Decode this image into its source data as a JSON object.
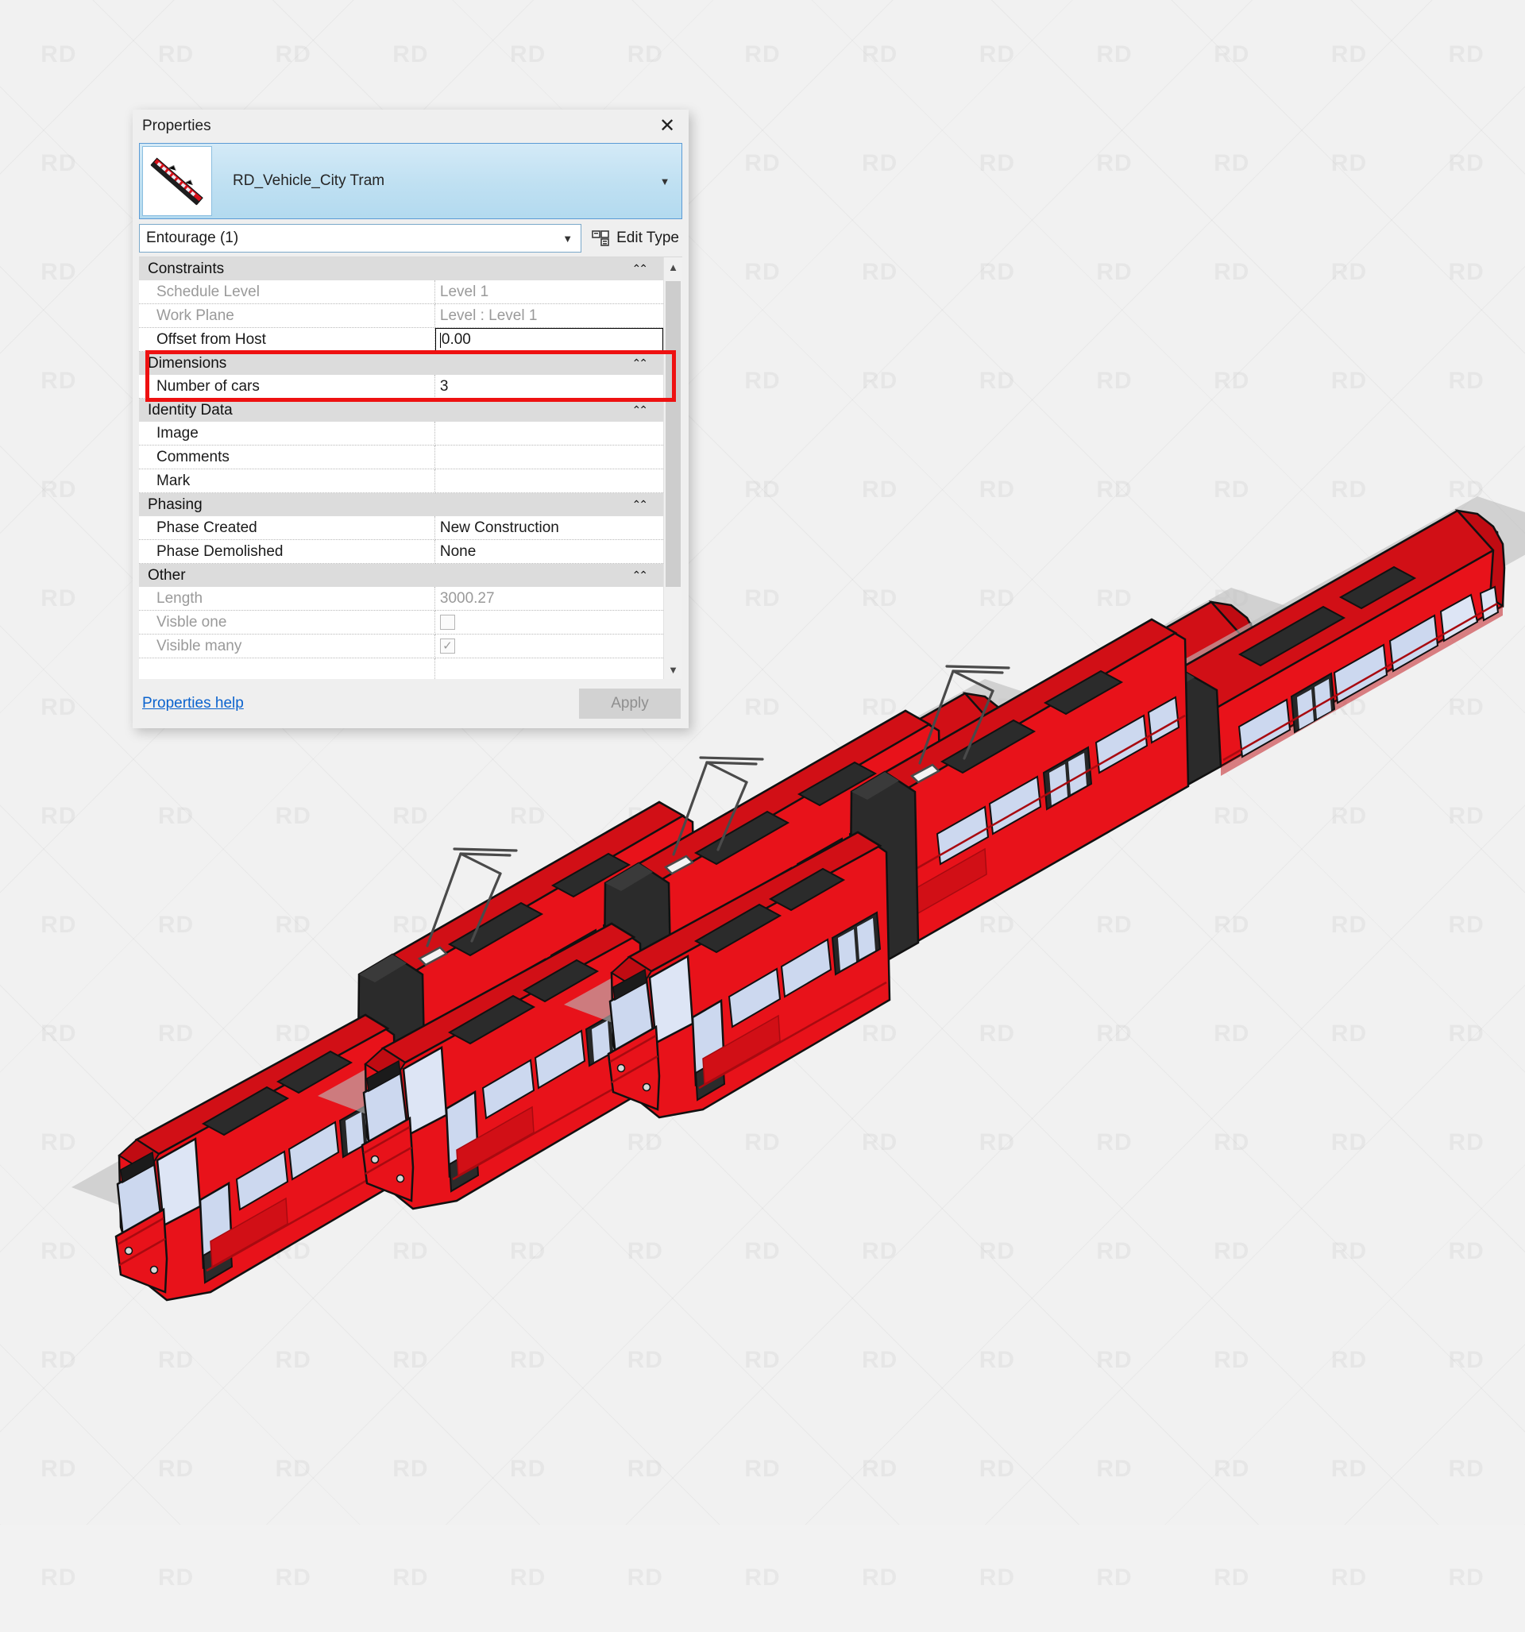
{
  "watermark": {
    "text": "RD"
  },
  "palette": {
    "title": "Properties",
    "close_icon": "close-icon",
    "type_selector": {
      "family_type": "RD_Vehicle_City Tram",
      "caret_icon": "chevron-down-icon",
      "thumbnail_alt": "tram-preview-thumbnail"
    },
    "category_select": {
      "value": "Entourage (1)",
      "caret_icon": "chevron-down-icon"
    },
    "edit_type": {
      "label": "Edit Type",
      "icon": "edit-type-icon"
    },
    "groups": [
      {
        "name": "Constraints",
        "collapse_icon": "double-chevron-up-icon",
        "rows": [
          {
            "label": "Schedule Level",
            "value": "Level 1",
            "label_dim": true,
            "value_dim": true,
            "type": "text"
          },
          {
            "label": "Work Plane",
            "value": "Level : Level 1",
            "label_dim": true,
            "value_dim": true,
            "type": "text"
          },
          {
            "label": "Offset from Host",
            "value": "0.00",
            "label_dim": false,
            "value_dim": false,
            "type": "editing"
          }
        ]
      },
      {
        "name": "Dimensions",
        "collapse_icon": "double-chevron-up-icon",
        "highlighted": true,
        "rows": [
          {
            "label": "Number of cars",
            "value": "3",
            "label_dim": false,
            "value_dim": false,
            "type": "text"
          }
        ]
      },
      {
        "name": "Identity Data",
        "collapse_icon": "double-chevron-up-icon",
        "rows": [
          {
            "label": "Image",
            "value": "",
            "label_dim": false,
            "value_dim": false,
            "type": "text"
          },
          {
            "label": "Comments",
            "value": "",
            "label_dim": false,
            "value_dim": false,
            "type": "text"
          },
          {
            "label": "Mark",
            "value": "",
            "label_dim": false,
            "value_dim": false,
            "type": "text"
          }
        ]
      },
      {
        "name": "Phasing",
        "collapse_icon": "double-chevron-up-icon",
        "rows": [
          {
            "label": "Phase Created",
            "value": "New Construction",
            "label_dim": false,
            "value_dim": false,
            "type": "text"
          },
          {
            "label": "Phase Demolished",
            "value": "None",
            "label_dim": false,
            "value_dim": false,
            "type": "text"
          }
        ]
      },
      {
        "name": "Other",
        "collapse_icon": "double-chevron-up-icon",
        "rows": [
          {
            "label": "Length",
            "value": "3000.27",
            "label_dim": true,
            "value_dim": true,
            "type": "text"
          },
          {
            "label": "Visble one",
            "value": "",
            "label_dim": true,
            "value_dim": true,
            "type": "checkbox",
            "checked": false
          },
          {
            "label": "Visible many",
            "value": "",
            "label_dim": true,
            "value_dim": true,
            "type": "checkbox",
            "checked": true
          }
        ]
      }
    ],
    "scrollbar": {
      "up_icon": "chevron-up-icon",
      "down_icon": "chevron-down-icon"
    },
    "footer": {
      "help_label": "Properties help",
      "apply_label": "Apply"
    }
  },
  "highlight": {
    "color": "#ee1111"
  },
  "scene": {
    "name": "isometric-tram-render",
    "vehicle_count": 3,
    "colors": {
      "body_red": "#e8121a",
      "body_red_dark": "#c00b12",
      "body_red_shade": "#d10f16",
      "glass": "#ccd8ef",
      "glass_light": "#dde5f5",
      "roof_unit": "#2b2b2b",
      "door_frame": "#262626",
      "outline": "#111111",
      "shadow": "#b9b9b9"
    }
  }
}
